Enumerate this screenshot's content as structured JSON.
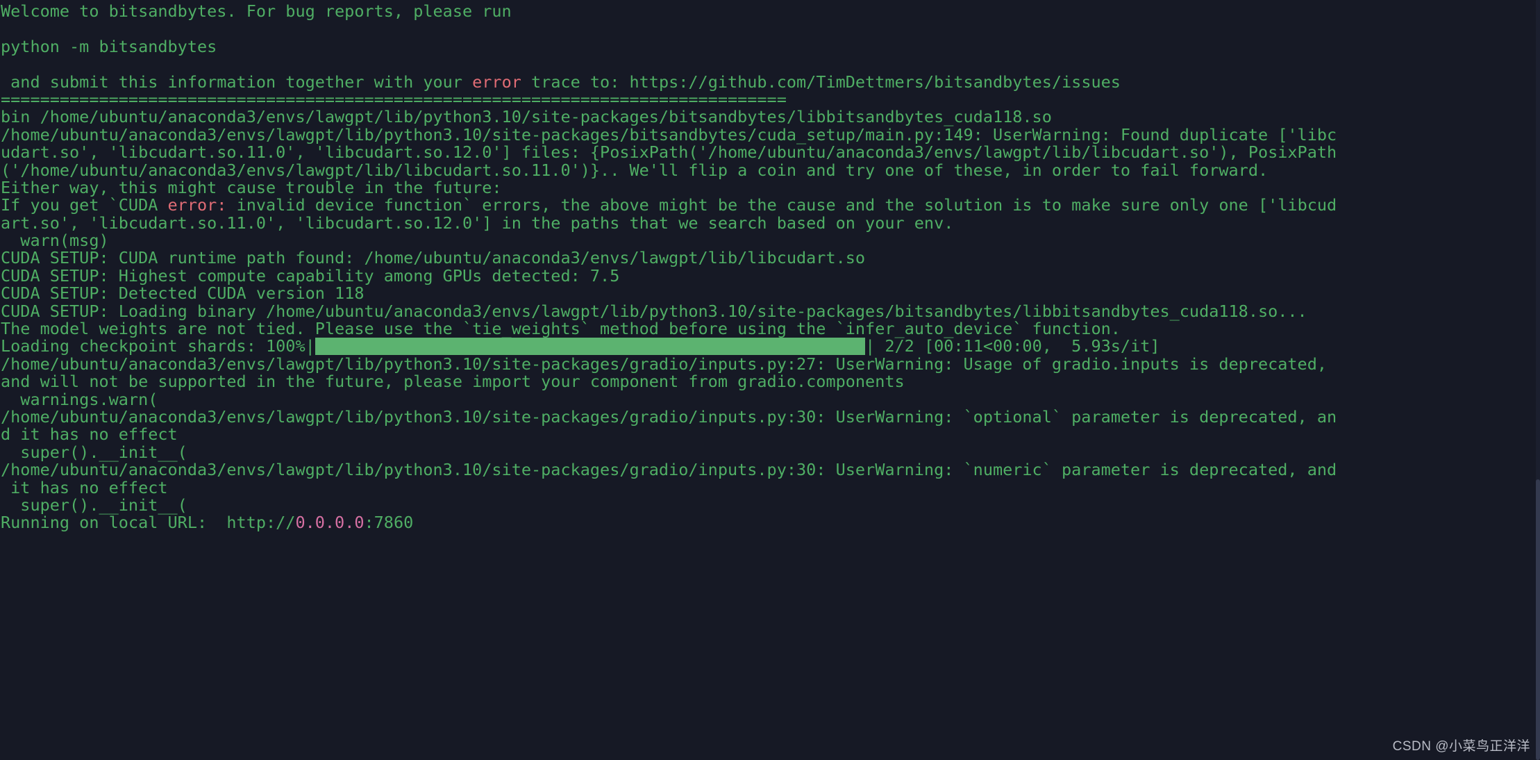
{
  "terminal": {
    "title": "bitsandbytes / LawGPT gradio launch console output",
    "background_color": "#161925",
    "text_color": "#4fae64",
    "error_color": "#e06c75",
    "url_host_color": "#d670a3",
    "progress_bar_color": "#5cb370",
    "lines": [
      {
        "id": "l01",
        "segments": [
          {
            "text": "Welcome to bitsandbytes. For bug reports, please run",
            "color": "green"
          }
        ]
      },
      {
        "id": "l02",
        "segments": [
          {
            "text": "",
            "color": "green"
          }
        ]
      },
      {
        "id": "l03",
        "segments": [
          {
            "text": "python -m bitsandbytes",
            "color": "green"
          }
        ]
      },
      {
        "id": "l04",
        "segments": [
          {
            "text": "",
            "color": "green"
          }
        ]
      },
      {
        "id": "l05",
        "segments": [
          {
            "text": " and submit this information together with your ",
            "color": "green"
          },
          {
            "text": "error",
            "color": "red"
          },
          {
            "text": " trace to: https://github.com/TimDettmers/bitsandbytes/issues",
            "color": "green"
          }
        ]
      },
      {
        "id": "l06",
        "segments": [
          {
            "text": "================================================================================",
            "color": "green"
          }
        ]
      },
      {
        "id": "l07",
        "segments": [
          {
            "text": "bin /home/ubuntu/anaconda3/envs/lawgpt/lib/python3.10/site-packages/bitsandbytes/libbitsandbytes_cuda118.so",
            "color": "green"
          }
        ]
      },
      {
        "id": "l08",
        "segments": [
          {
            "text": "/home/ubuntu/anaconda3/envs/lawgpt/lib/python3.10/site-packages/bitsandbytes/cuda_setup/main.py:149: UserWarning: Found duplicate ['libc",
            "color": "green"
          }
        ]
      },
      {
        "id": "l09",
        "segments": [
          {
            "text": "udart.so', 'libcudart.so.11.0', 'libcudart.so.12.0'] files: {PosixPath('/home/ubuntu/anaconda3/envs/lawgpt/lib/libcudart.so'), PosixPath",
            "color": "green"
          }
        ]
      },
      {
        "id": "l10",
        "segments": [
          {
            "text": "('/home/ubuntu/anaconda3/envs/lawgpt/lib/libcudart.so.11.0')}.. We'll flip a coin and try one of these, in order to fail forward.",
            "color": "green"
          }
        ]
      },
      {
        "id": "l11",
        "segments": [
          {
            "text": "Either way, this might cause trouble in the future:",
            "color": "green"
          }
        ]
      },
      {
        "id": "l12",
        "segments": [
          {
            "text": "If you get `CUDA ",
            "color": "green"
          },
          {
            "text": "error:",
            "color": "red"
          },
          {
            "text": " invalid device function` errors, the above might be the cause and the solution is to make sure only one ['libcud",
            "color": "green"
          }
        ]
      },
      {
        "id": "l13",
        "segments": [
          {
            "text": "art.so', 'libcudart.so.11.0', 'libcudart.so.12.0'] in the paths that we search based on your env.",
            "color": "green"
          }
        ]
      },
      {
        "id": "l14",
        "segments": [
          {
            "text": "  warn(msg)",
            "color": "green"
          }
        ]
      },
      {
        "id": "l15",
        "segments": [
          {
            "text": "CUDA SETUP: CUDA runtime path found: /home/ubuntu/anaconda3/envs/lawgpt/lib/libcudart.so",
            "color": "green"
          }
        ]
      },
      {
        "id": "l16",
        "segments": [
          {
            "text": "CUDA SETUP: Highest compute capability among GPUs detected: 7.5",
            "color": "green"
          }
        ]
      },
      {
        "id": "l17",
        "segments": [
          {
            "text": "CUDA SETUP: Detected CUDA version 118",
            "color": "green"
          }
        ]
      },
      {
        "id": "l18",
        "segments": [
          {
            "text": "CUDA SETUP: Loading binary /home/ubuntu/anaconda3/envs/lawgpt/lib/python3.10/site-packages/bitsandbytes/libbitsandbytes_cuda118.so...",
            "color": "green"
          }
        ]
      },
      {
        "id": "l19",
        "segments": [
          {
            "text": "The model weights are not tied. Please use the `tie_weights` method before using the `infer_auto_device` function.",
            "color": "green"
          }
        ]
      },
      {
        "id": "l20",
        "segments": [
          {
            "text": "Loading checkpoint shards: 100%|",
            "color": "green"
          },
          {
            "text": "████████████████████████████████████████████████████████",
            "color": "bar"
          },
          {
            "text": "| 2/2 [00:11<00:00,  5.93s/it]",
            "color": "green"
          }
        ]
      },
      {
        "id": "l21",
        "segments": [
          {
            "text": "/home/ubuntu/anaconda3/envs/lawgpt/lib/python3.10/site-packages/gradio/inputs.py:27: UserWarning: Usage of gradio.inputs is deprecated,",
            "color": "green"
          }
        ]
      },
      {
        "id": "l22",
        "segments": [
          {
            "text": "and will not be supported in the future, please import your component from gradio.components",
            "color": "green"
          }
        ]
      },
      {
        "id": "l23",
        "segments": [
          {
            "text": "  warnings.warn(",
            "color": "green"
          }
        ]
      },
      {
        "id": "l24",
        "segments": [
          {
            "text": "/home/ubuntu/anaconda3/envs/lawgpt/lib/python3.10/site-packages/gradio/inputs.py:30: UserWarning: `optional` parameter is deprecated, an",
            "color": "green"
          }
        ]
      },
      {
        "id": "l25",
        "segments": [
          {
            "text": "d it has no effect",
            "color": "green"
          }
        ]
      },
      {
        "id": "l26",
        "segments": [
          {
            "text": "  super().__init__(",
            "color": "green"
          }
        ]
      },
      {
        "id": "l27",
        "segments": [
          {
            "text": "/home/ubuntu/anaconda3/envs/lawgpt/lib/python3.10/site-packages/gradio/inputs.py:30: UserWarning: `numeric` parameter is deprecated, and",
            "color": "green"
          }
        ]
      },
      {
        "id": "l28",
        "segments": [
          {
            "text": " it has no effect",
            "color": "green"
          }
        ]
      },
      {
        "id": "l29",
        "segments": [
          {
            "text": "  super().__init__(",
            "color": "green"
          }
        ]
      },
      {
        "id": "l30",
        "segments": [
          {
            "text": "Running on local URL:  http://",
            "color": "green"
          },
          {
            "text": "0.0.0.0",
            "color": "pink"
          },
          {
            "text": ":7860",
            "color": "green"
          }
        ]
      }
    ],
    "progress": {
      "label": "Loading checkpoint shards:",
      "percent": "100%",
      "count": "2/2",
      "elapsed": "00:11",
      "remaining": "00:00",
      "rate": "5.93s/it"
    },
    "local_url": "http://0.0.0.0:7860"
  },
  "watermark": {
    "text": "CSDN @小菜鸟正洋洋"
  }
}
